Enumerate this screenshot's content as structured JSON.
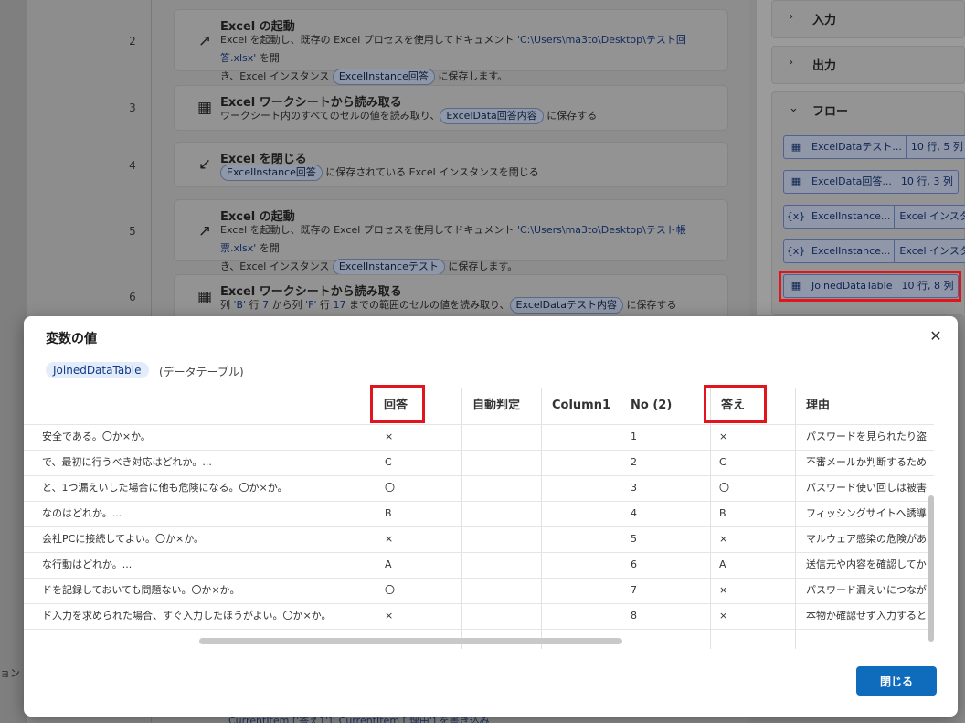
{
  "left_fragment": "ョン",
  "flow": {
    "steps": [
      {
        "num": "2",
        "title": "Excel の起動",
        "line1_pre": "Excel を起動し、既存の Excel プロセスを使用してドキュメント ",
        "path": "'C:\\Users\\ma3to\\Desktop\\テスト回答.xlsx'",
        "line1_post": " を開",
        "line2_pre": "き、Excel インスタンス ",
        "chip": "ExcelInstance回答",
        "line2_post": " に保存します。",
        "icon": "arrow-up-right-icon"
      },
      {
        "num": "3",
        "title": "Excel ワークシートから読み取る",
        "line1_pre": "ワークシート内のすべてのセルの値を読み取り、",
        "chip": "ExcelData回答内容",
        "line1_post": " に保存する",
        "icon": "excel-read-icon"
      },
      {
        "num": "4",
        "title": "Excel を閉じる",
        "chip": "ExcelInstance回答",
        "line1_post": " に保存されている Excel インスタンスを閉じる",
        "icon": "arrow-down-left-icon"
      },
      {
        "num": "5",
        "title": "Excel の起動",
        "line1_pre": "Excel を起動し、既存の Excel プロセスを使用してドキュメント ",
        "path": "'C:\\Users\\ma3to\\Desktop\\テスト帳票.xlsx'",
        "line1_post": " を開",
        "line2_pre": "き、Excel インスタンス ",
        "chip": "ExcelInstanceテスト",
        "line2_post": " に保存します。",
        "icon": "arrow-up-right-icon"
      },
      {
        "num": "6",
        "title": "Excel ワークシートから読み取る",
        "parts": [
          "列 ",
          "'B'",
          " 行 ",
          "7",
          " から列 ",
          "'F'",
          " 行 ",
          "17",
          " までの範囲のセルの値を読み取り、"
        ],
        "chip": "ExcelDataテスト内容",
        "line1_post": " に保存する",
        "icon": "excel-read-icon"
      }
    ],
    "bottom_fragment": "CurrentItem ['答え1']; CurrentItem ['理由'] を書き込み"
  },
  "right_panel": {
    "sections": [
      {
        "label": "入力",
        "chevron": "›"
      },
      {
        "label": "出力",
        "chevron": "›"
      },
      {
        "label": "フロー",
        "chevron": "⌄"
      }
    ],
    "variables": [
      {
        "icon": "▦",
        "name": "ExcelDataテスト...",
        "value": "10 行, 5 列"
      },
      {
        "icon": "▦",
        "name": "ExcelData回答...",
        "value": "10 行, 3 列"
      },
      {
        "icon": "{x}",
        "name": "ExcelInstance...",
        "value": "Excel インスタンス"
      },
      {
        "icon": "{x}",
        "name": "ExcelInstance...",
        "value": "Excel インスタンス"
      },
      {
        "icon": "▦",
        "name": "JoinedDataTable",
        "value": "10 行, 8 列"
      }
    ]
  },
  "modal": {
    "title": "変数の値",
    "variable_name": "JoinedDataTable",
    "variable_type": "(データテーブル)",
    "close_label": "閉じる",
    "columns": [
      "回答",
      "自動判定",
      "Column1",
      "No (2)",
      "答え",
      "理由"
    ],
    "rows": [
      {
        "q": "安全である。〇か×か。",
        "ans": "×",
        "auto": "",
        "c1": "",
        "no": "1",
        "key": "×",
        "reason": "パスワードを見られたり盗まれ"
      },
      {
        "q": "で、最初に行うべき対応はどれか。...",
        "ans": "C",
        "auto": "",
        "c1": "",
        "no": "2",
        "key": "C",
        "reason": "不審メールか判断するために"
      },
      {
        "q": "と、1つ漏えいした場合に他も危険になる。〇か×か。",
        "ans": "〇",
        "auto": "",
        "c1": "",
        "no": "3",
        "key": "〇",
        "reason": "パスワード使い回しは被害拡"
      },
      {
        "q": "なのはどれか。...",
        "ans": "B",
        "auto": "",
        "c1": "",
        "no": "4",
        "key": "B",
        "reason": "フィッシングサイトへ誘導され"
      },
      {
        "q": "会社PCに接続してよい。〇か×か。",
        "ans": "×",
        "auto": "",
        "c1": "",
        "no": "5",
        "key": "×",
        "reason": "マルウェア感染の危険がある"
      },
      {
        "q": "な行動はどれか。...",
        "ans": "A",
        "auto": "",
        "c1": "",
        "no": "6",
        "key": "A",
        "reason": "送信元や内容を確認してか"
      },
      {
        "q": "ドを記録しておいても問題ない。〇か×か。",
        "ans": "〇",
        "auto": "",
        "c1": "",
        "no": "7",
        "key": "×",
        "reason": "パスワード漏えいにつながるた"
      },
      {
        "q": "ド入力を求められた場合、すぐ入力したほうがよい。〇か×か。",
        "ans": "×",
        "auto": "",
        "c1": "",
        "no": "8",
        "key": "×",
        "reason": "本物か確認せず入力すると"
      }
    ]
  }
}
